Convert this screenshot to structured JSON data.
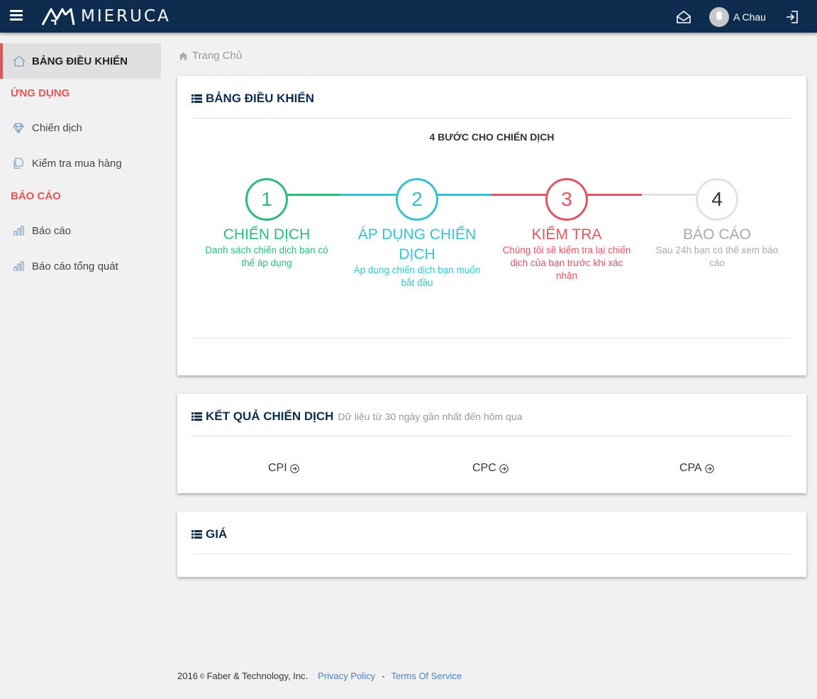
{
  "header": {
    "logo_text": "MIERUCA",
    "user_name": "A Chau"
  },
  "sidebar": {
    "active_label": "BẢNG ĐIỀU KHIỂN",
    "section_apps": "ỨNG DỤNG",
    "items_apps": [
      {
        "label": "Chiến dịch",
        "icon": "diamond-icon"
      },
      {
        "label": "Kiểm tra mua hàng",
        "icon": "copy-icon"
      }
    ],
    "section_reports": "BÁO CÁO",
    "items_reports": [
      {
        "label": "Báo cáo",
        "icon": "bar-chart-icon"
      },
      {
        "label": "Báo cáo tổng quát",
        "icon": "bar-chart-icon"
      }
    ]
  },
  "breadcrumb": {
    "label": "Trang Chủ"
  },
  "dashboard": {
    "title": "BẢNG ĐIỀU KHIỂN",
    "steps_title": "4 BƯỚC CHO CHIẾN DỊCH",
    "steps": [
      {
        "number": "1",
        "name": "CHIẾN DỊCH",
        "desc": "Danh sách chiến dịch bạn có thể áp dụng",
        "color": "#2dbb7a"
      },
      {
        "number": "2",
        "name": "ÁP DỤNG CHIẾN DỊCH",
        "desc": "Áp dụng chiến dịch bạn muốn bắt đầu",
        "color": "#35c2cf"
      },
      {
        "number": "3",
        "name": "KIỂM TRA",
        "desc": "Chúng tôi sẽ kiểm tra lại chiến dịch của bạn trước khi xác nhận",
        "color": "#e05360"
      },
      {
        "number": "4",
        "name": "BÁO CÁO",
        "desc": "Sau 24h bạn có thể xem báo cáo",
        "color": "#aaaaaa"
      }
    ]
  },
  "results": {
    "title": "KẾT QUẢ CHIẾN DỊCH",
    "subtitle": "Dữ liệu từ 30 ngày gần nhất đến hôm qua",
    "metrics": [
      "CPI",
      "CPC",
      "CPA"
    ]
  },
  "price": {
    "title": "GIÁ"
  },
  "footer": {
    "year": "2016",
    "copyright_symbol": "©",
    "company": "Faber & Technology, Inc.",
    "privacy": "Privacy Policy",
    "separator": "-",
    "terms": "Terms Of Service"
  }
}
